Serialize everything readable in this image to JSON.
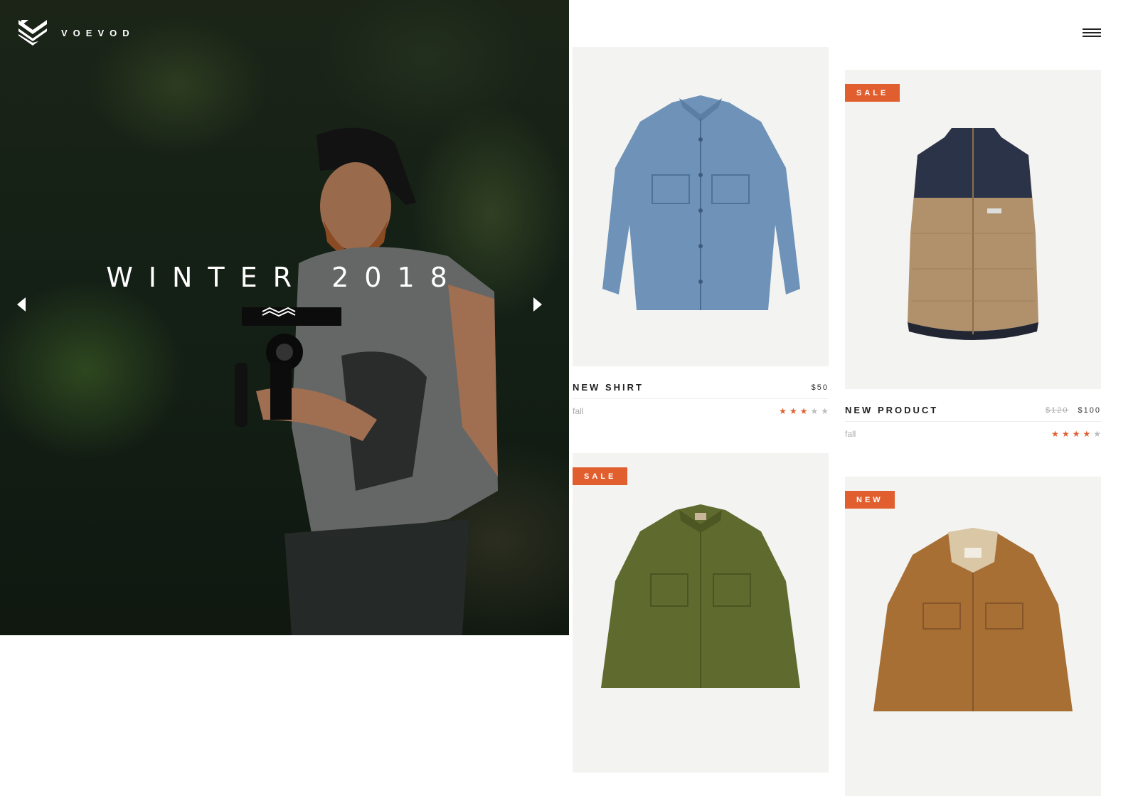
{
  "header": {
    "brand": "VOEVOD"
  },
  "hero": {
    "title": "WINTER 2018",
    "prev_icon": "triangle-left-icon",
    "next_icon": "triangle-right-icon",
    "ornament_icon": "double-chevron-wave-icon"
  },
  "menu": {
    "icon": "hamburger-menu-icon"
  },
  "colors": {
    "accent": "#e15f2f",
    "hero_foliage": "#1b2417",
    "card_bg": "#f3f3f1"
  },
  "products": [
    {
      "name": "NEW SHIRT",
      "price": "$50",
      "old_price": "",
      "category": "fall",
      "badge": "",
      "rating": 3,
      "rating_max": 5,
      "image_icon": "denim-shirt-image"
    },
    {
      "name": "NEW PRODUCT",
      "price": "$100",
      "old_price": "$120",
      "category": "fall",
      "badge": "SALE",
      "rating": 4,
      "rating_max": 5,
      "image_icon": "puffer-vest-image"
    },
    {
      "name": "",
      "price": "",
      "old_price": "",
      "category": "",
      "badge": "SALE",
      "rating": null,
      "rating_max": 5,
      "image_icon": "green-jacket-image"
    },
    {
      "name": "",
      "price": "",
      "old_price": "",
      "category": "",
      "badge": "NEW",
      "rating": null,
      "rating_max": 5,
      "image_icon": "brown-jacket-image"
    }
  ]
}
